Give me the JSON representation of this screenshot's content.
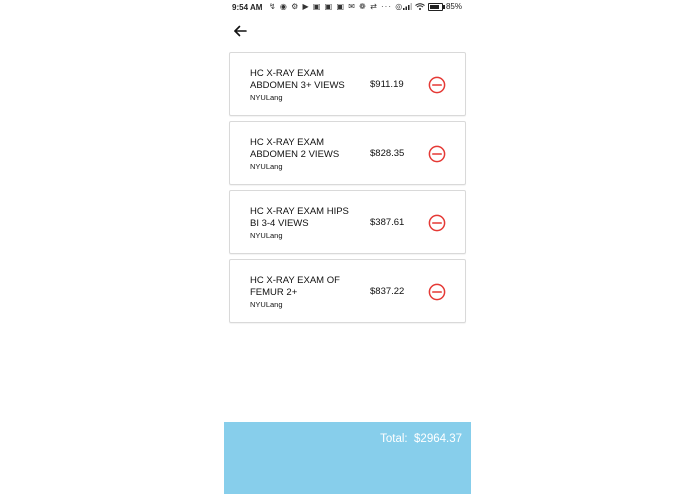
{
  "status_bar": {
    "time": "9:54 AM",
    "icons": "↯ ◉ ⚙ ▶ ▣ ▣ ▣ ✉ ❁ ⇄ ··· ◎",
    "battery": "85%"
  },
  "colors": {
    "accent_remove": "#e53935",
    "total_bar": "#87ceeb"
  },
  "items": [
    {
      "name": "HC X-RAY EXAM ABDOMEN 3+ VIEWS",
      "provider": "NYULang",
      "price": "$911.19"
    },
    {
      "name": "HC X-RAY EXAM ABDOMEN 2 VIEWS",
      "provider": "NYULang",
      "price": "$828.35"
    },
    {
      "name": "HC X-RAY EXAM HIPS BI 3-4 VIEWS",
      "provider": "NYULang",
      "price": "$387.61"
    },
    {
      "name": "HC X-RAY EXAM OF FEMUR 2+",
      "provider": "NYULang",
      "price": "$837.22"
    }
  ],
  "total": {
    "label": "Total:",
    "value": "$2964.37"
  }
}
